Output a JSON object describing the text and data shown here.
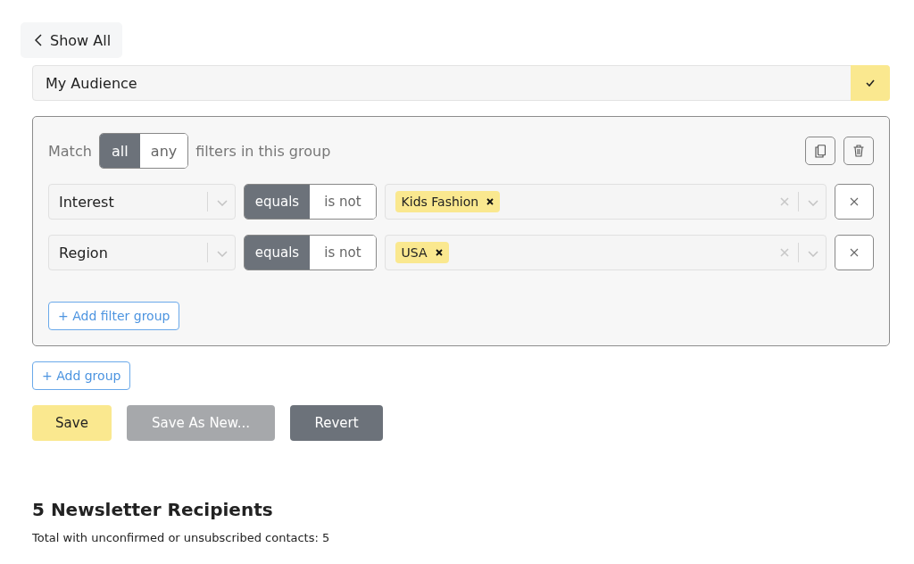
{
  "back_button": {
    "label": "Show All"
  },
  "audience": {
    "value": "My Audience"
  },
  "group": {
    "match_label": "Match",
    "match_options": [
      {
        "label": "all",
        "selected": true
      },
      {
        "label": "any",
        "selected": false
      }
    ],
    "match_suffix": "filters in this group",
    "filters": [
      {
        "field": "Interest",
        "operators": [
          {
            "label": "equals",
            "selected": true
          },
          {
            "label": "is not",
            "selected": false
          }
        ],
        "values": [
          "Kids Fashion"
        ]
      },
      {
        "field": "Region",
        "operators": [
          {
            "label": "equals",
            "selected": true
          },
          {
            "label": "is not",
            "selected": false
          }
        ],
        "values": [
          "USA"
        ]
      }
    ],
    "add_filter_group": "+ Add filter group"
  },
  "add_group": "+ Add group",
  "actions": [
    {
      "label": "Save",
      "kind": "primary",
      "disabled": false
    },
    {
      "label": "Save As New...",
      "kind": "secondary",
      "disabled": true
    },
    {
      "label": "Revert",
      "kind": "dark",
      "disabled": false
    }
  ],
  "results": {
    "title": "5 Newsletter Recipients",
    "note": "Total with unconfirmed or unsubscribed contacts: 5"
  }
}
